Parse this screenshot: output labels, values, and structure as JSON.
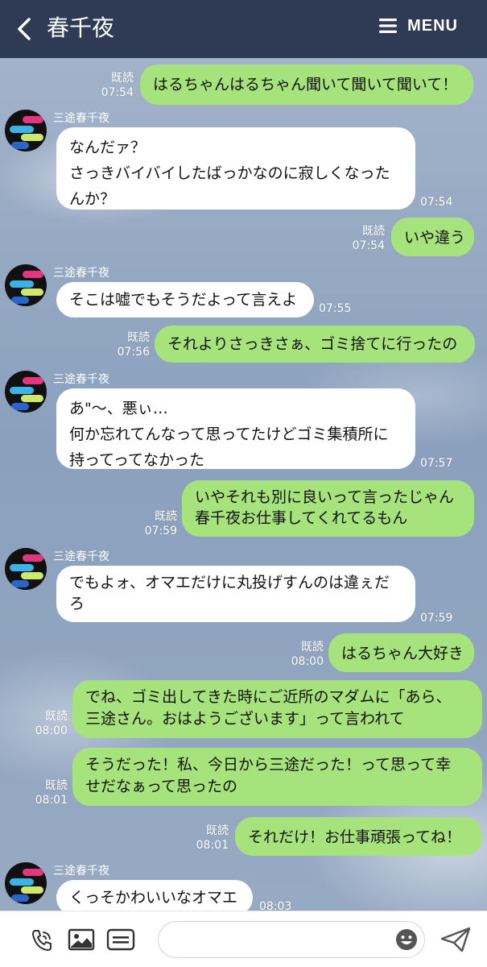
{
  "header": {
    "title": "春千夜",
    "menu_label": "MENU"
  },
  "read_label": "既読",
  "messages": [
    {
      "dir": "out",
      "text": "はるちゃんはるちゃん聞いて聞いて聞いて！",
      "time": "07:54",
      "read": "既読"
    },
    {
      "dir": "in",
      "sender": "三途春千夜",
      "lines": [
        "なんだァ？",
        "さっきバイバイしたばっかなのに寂しくなった",
        "んか？"
      ],
      "time": "07:54"
    },
    {
      "dir": "out",
      "text": "いや違う",
      "time": "07:54",
      "read": "既読"
    },
    {
      "dir": "in",
      "sender": "三途春千夜",
      "lines": [
        "そこは嘘でもそうだよって言えよ"
      ],
      "time": "07:55"
    },
    {
      "dir": "out",
      "text": "それよりさっきさぁ、ゴミ捨てに行ったの",
      "time": "07:56",
      "read": "既読"
    },
    {
      "dir": "in",
      "sender": "三途春千夜",
      "lines": [
        "あ\"〜、悪ぃ…",
        "何か忘れてんなって思ってたけどゴミ集積所に",
        "持ってってなかった"
      ],
      "time": "07:57"
    },
    {
      "dir": "out",
      "lines": [
        "いやそれも別に良いって言ったじゃん",
        "春千夜お仕事してくれてるもん"
      ],
      "time": "07:59",
      "read": "既読"
    },
    {
      "dir": "in",
      "sender": "三途春千夜",
      "lines": [
        "でもよォ、オマエだけに丸投げすんのは違ぇだ",
        "ろ"
      ],
      "time": "07:59"
    },
    {
      "dir": "out",
      "text": "はるちゃん大好き",
      "time": "08:00",
      "read": "既読"
    },
    {
      "dir": "out",
      "lines": [
        "でね、ゴミ出してきた時にご近所のマダムに「あら、",
        "三途さん。おはようございます」って言われて"
      ],
      "time": "08:00",
      "read": "既読"
    },
    {
      "dir": "out",
      "lines": [
        "そうだった！私、今日から三途だった！って思って幸",
        "せだなぁって思ったの"
      ],
      "time": "08:01",
      "read": "既読"
    },
    {
      "dir": "out",
      "text": "それだけ！お仕事頑張ってね！",
      "time": "08:01",
      "read": "既読"
    },
    {
      "dir": "in",
      "sender": "三途春千夜",
      "lines": [
        "くっそかわいいなオマエ"
      ],
      "time": "08:03"
    }
  ],
  "footer": {
    "icons": [
      "phone-icon",
      "image-icon",
      "keyboard-icon",
      "emoji-icon",
      "send-icon"
    ],
    "input_placeholder": ""
  },
  "colors": {
    "header": "#2f3b55",
    "outgoing_bubble": "#a6e37d",
    "incoming_bubble": "#ffffff"
  }
}
